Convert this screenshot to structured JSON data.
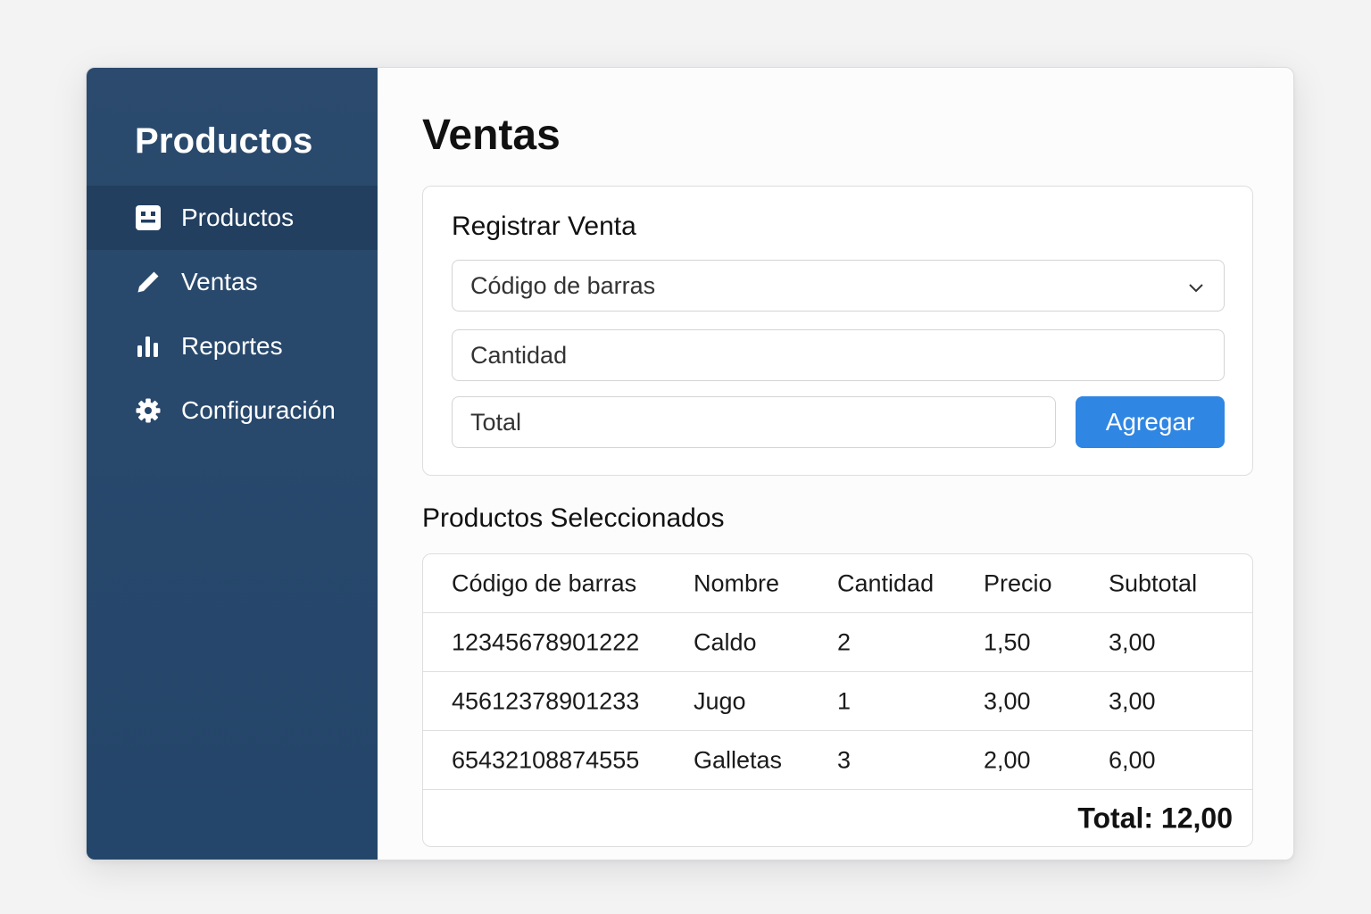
{
  "sidebar": {
    "title": "Productos",
    "items": [
      {
        "label": "Productos",
        "icon": "product-card-icon",
        "active": true
      },
      {
        "label": "Ventas",
        "icon": "pencil-icon",
        "active": false
      },
      {
        "label": "Reportes",
        "icon": "bar-chart-icon",
        "active": false
      },
      {
        "label": "Configuración",
        "icon": "gear-icon",
        "active": false
      }
    ]
  },
  "main": {
    "title": "Ventas",
    "form": {
      "title": "Registrar Venta",
      "barcode_select": "Código de barras",
      "quantity_placeholder": "Cantidad",
      "total_placeholder": "Total",
      "add_button": "Agregar"
    },
    "selected": {
      "title": "Productos Seleccionados",
      "columns": [
        "Código de barras",
        "Nombre",
        "Cantidad",
        "Precio",
        "Subtotal"
      ],
      "rows": [
        [
          "12345678901222",
          "Caldo",
          "2",
          "1,50",
          "3,00"
        ],
        [
          "45612378901233",
          "Jugo",
          "1",
          "3,00",
          "3,00"
        ],
        [
          "65432108874555",
          "Galletas",
          "3",
          "2,00",
          "6,00"
        ]
      ],
      "total": "Total: 12,00"
    }
  },
  "colors": {
    "sidebar": "#2b4a6d",
    "sidebar_active": "#223f60",
    "accent": "#2f86e3"
  }
}
